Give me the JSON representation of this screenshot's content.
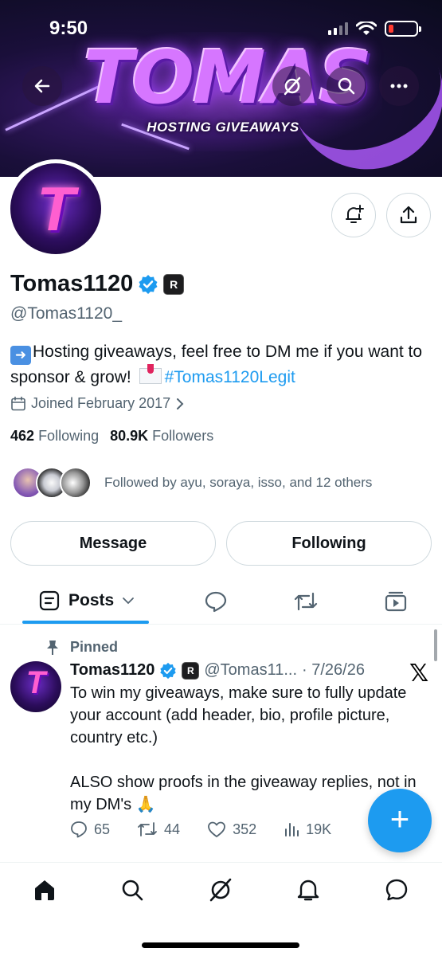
{
  "status_bar": {
    "time": "9:50"
  },
  "banner": {
    "title": "TOMAS",
    "subtitle": "HOSTING GIVEAWAYS"
  },
  "profile": {
    "name": "Tomas1120",
    "handle": "@Tomas1120_",
    "avatar_letter": "T",
    "bio_text": "Hosting giveaways, feel free to DM me if you want to sponsor & grow!",
    "bio_hashtag": "#Tomas1120Legit",
    "joined": "Joined February 2017",
    "following_count": "462",
    "following_label": "Following",
    "followers_count": "80.9K",
    "followers_label": "Followers",
    "followed_by": "Followed by ayu, soraya, isso, and 12 others"
  },
  "buttons": {
    "message": "Message",
    "following": "Following"
  },
  "tabs": {
    "posts_label": "Posts"
  },
  "post": {
    "pinned_label": "Pinned",
    "author": "Tomas1120",
    "handle": "@Tomas11...",
    "date": "· 7/26/26",
    "text": "To win my giveaways, make sure to fully update your account (add header, bio, profile picture, country etc.)\n\nALSO show proofs in the giveaway replies, not in my DM's 🙏",
    "replies": "65",
    "reposts": "44",
    "likes": "352",
    "views": "19K"
  },
  "colors": {
    "accent": "#1d9bf0",
    "text_secondary": "#536471",
    "banner_purple": "#d676ff"
  },
  "icons": [
    "back-arrow-icon",
    "grok-icon",
    "search-icon",
    "more-icon",
    "bell-plus-icon",
    "share-icon",
    "verified-icon",
    "calendar-icon",
    "chevron-right-icon",
    "posts-tab-icon",
    "chevron-down-icon",
    "replies-tab-icon",
    "reposts-tab-icon",
    "media-tab-icon",
    "pin-icon",
    "reply-icon",
    "repost-icon",
    "like-icon",
    "views-icon",
    "compose-icon",
    "home-icon",
    "grok-nav-icon",
    "notifications-icon",
    "messages-icon"
  ]
}
